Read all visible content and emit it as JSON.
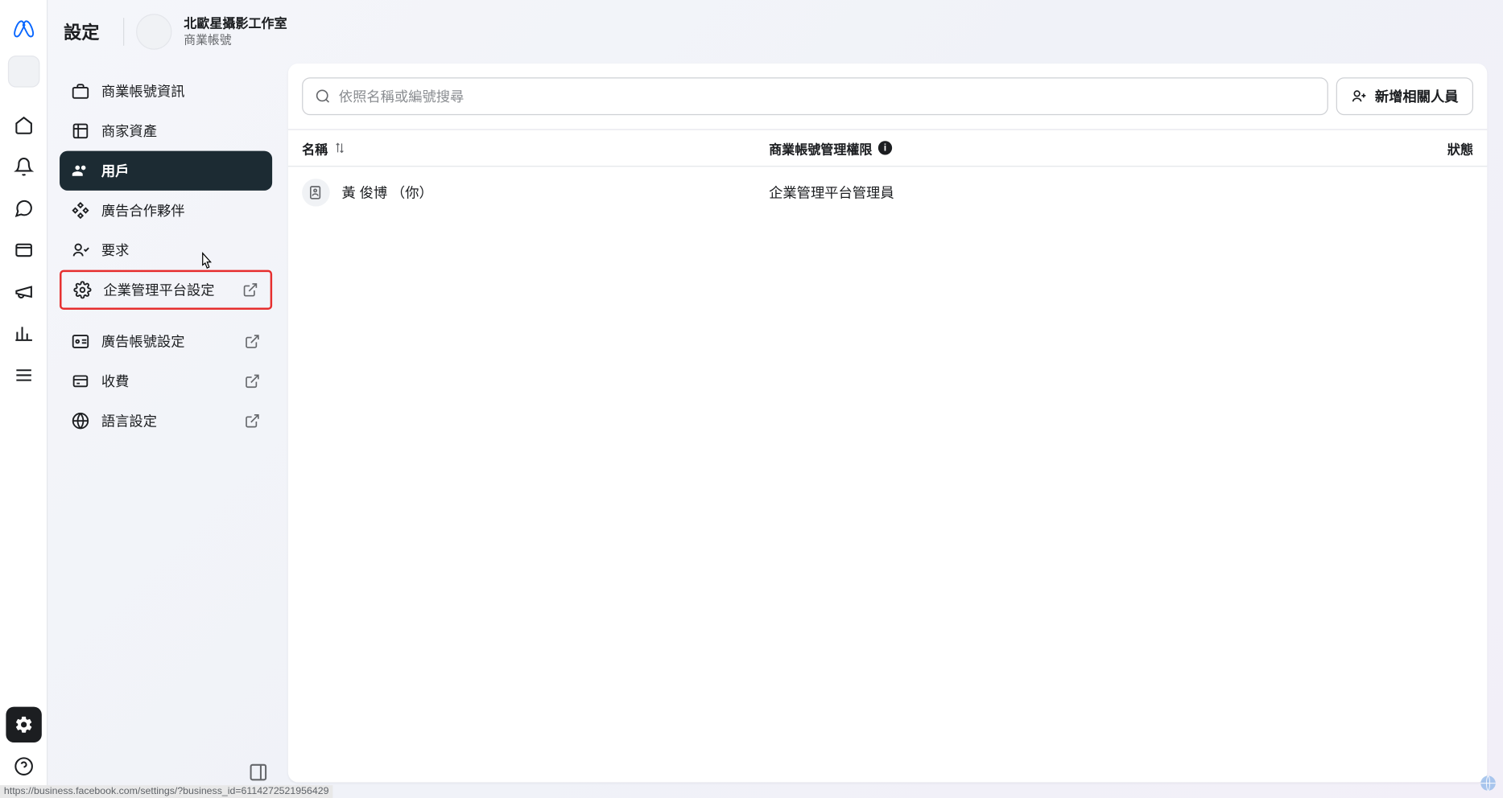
{
  "header": {
    "title": "設定",
    "account_name": "北歐星攝影工作室",
    "account_type": "商業帳號"
  },
  "sidebar": {
    "items": [
      {
        "label": "商業帳號資訊",
        "icon": "briefcase"
      },
      {
        "label": "商家資產",
        "icon": "assets"
      },
      {
        "label": "用戶",
        "icon": "users",
        "active": true
      },
      {
        "label": "廣告合作夥伴",
        "icon": "handshake"
      },
      {
        "label": "要求",
        "icon": "person-check"
      },
      {
        "label": "企業管理平台設定",
        "icon": "gear",
        "external": true,
        "highlighted": true
      },
      {
        "label": "廣告帳號設定",
        "icon": "ad-account",
        "external": true
      },
      {
        "label": "收費",
        "icon": "billing",
        "external": true
      },
      {
        "label": "語言設定",
        "icon": "globe",
        "external": true
      }
    ]
  },
  "main": {
    "search_placeholder": "依照名稱或編號搜尋",
    "add_button": "新增相關人員",
    "columns": {
      "name": "名稱",
      "permission": "商業帳號管理權限",
      "status": "狀態"
    },
    "rows": [
      {
        "name": "黃 俊博 （你）",
        "permission": "企業管理平台管理員",
        "status": ""
      }
    ]
  },
  "status_url": "https://business.facebook.com/settings/?business_id=6114272521956429"
}
